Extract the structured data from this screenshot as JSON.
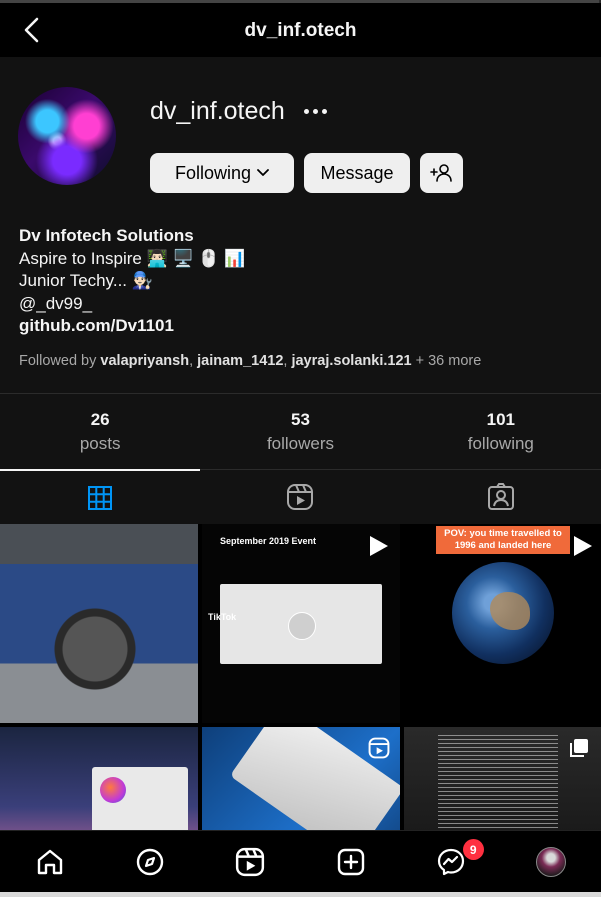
{
  "header": {
    "title": "dv_inf.otech"
  },
  "profile": {
    "username": "dv_inf.otech",
    "buttons": {
      "following": "Following",
      "message": "Message"
    },
    "bio": {
      "name": "Dv Infotech Solutions",
      "line1": "Aspire to Inspire 👨🏻‍💻 🖥️ 🖱️ 📊",
      "line2": "Junior Techy... 👨🏻‍🔧",
      "handle": "@_dv99_",
      "link": "github.com/Dv1101"
    },
    "followed_by": {
      "prefix": "Followed by",
      "names": [
        "valapriyansh",
        "jainam_1412",
        "jayraj.solanki.121"
      ],
      "more": "+ 36 more"
    }
  },
  "stats": [
    {
      "num": "26",
      "label": "posts"
    },
    {
      "num": "53",
      "label": "followers"
    },
    {
      "num": "101",
      "label": "following"
    }
  ],
  "tabs": [
    "grid-icon",
    "reels-icon",
    "tagged-icon"
  ],
  "grid": {
    "cell2_text1": "September 2019 Event",
    "cell2_text2": "TikTok",
    "cell3_pov": "POV: you time travelled to 1996 and landed here"
  },
  "bottom_nav": {
    "icons": [
      "home-icon",
      "explore-icon",
      "reels-icon",
      "create-icon",
      "messenger-icon",
      "profile-avatar"
    ],
    "messenger_badge": "9"
  }
}
